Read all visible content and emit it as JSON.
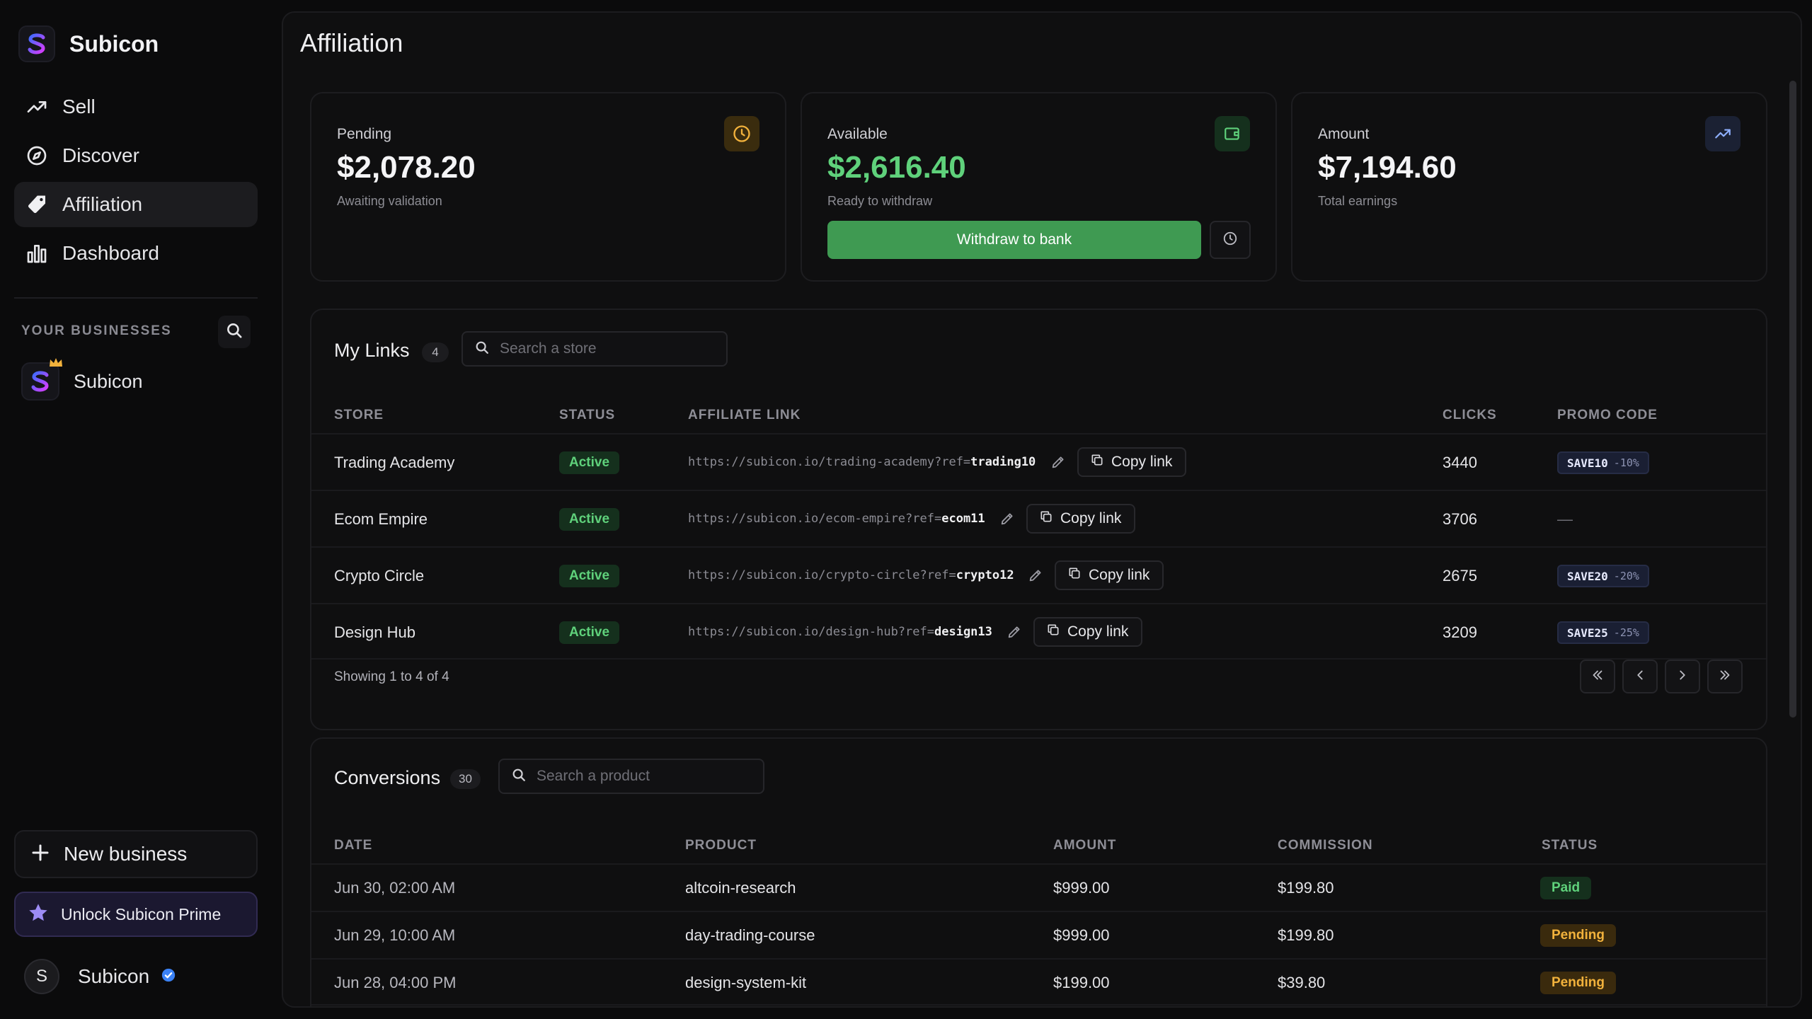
{
  "brand": {
    "name": "Subicon"
  },
  "nav": [
    {
      "label": "Sell",
      "icon": "trending-up-icon"
    },
    {
      "label": "Discover",
      "icon": "compass-icon"
    },
    {
      "label": "Affiliation",
      "icon": "tag-icon",
      "active": true
    },
    {
      "label": "Dashboard",
      "icon": "bar-chart-icon"
    }
  ],
  "businesses": {
    "title": "YOUR BUSINESSES",
    "items": [
      {
        "name": "Subicon"
      }
    ]
  },
  "sidebar_bottom": {
    "new_business": "New business",
    "prime": "Unlock Subicon Prime",
    "user_initial": "S",
    "user_name": "Subicon"
  },
  "page": {
    "title": "Affiliation"
  },
  "stats": {
    "pending": {
      "label": "Pending",
      "value": "$2,078.20",
      "sub": "Awaiting validation"
    },
    "available": {
      "label": "Available",
      "value": "$2,616.40",
      "sub": "Ready to withdraw",
      "button": "Withdraw to bank"
    },
    "amount": {
      "label": "Amount",
      "value": "$7,194.60",
      "sub": "Total earnings"
    }
  },
  "links": {
    "title": "My Links",
    "count": "4",
    "search_placeholder": "Search a store",
    "columns": [
      "STORE",
      "STATUS",
      "AFFILIATE LINK",
      "CLICKS",
      "PROMO CODE"
    ],
    "copy_label": "Copy link",
    "rows": [
      {
        "store": "Trading Academy",
        "status": "Active",
        "link_base": "https://subicon.io/trading-academy?ref=",
        "ref": "trading10",
        "clicks": "3440",
        "promo": "SAVE10",
        "pct": "-10%"
      },
      {
        "store": "Ecom Empire",
        "status": "Active",
        "link_base": "https://subicon.io/ecom-empire?ref=",
        "ref": "ecom11",
        "clicks": "3706",
        "promo": "",
        "pct": "",
        "no_promo": "—"
      },
      {
        "store": "Crypto Circle",
        "status": "Active",
        "link_base": "https://subicon.io/crypto-circle?ref=",
        "ref": "crypto12",
        "clicks": "2675",
        "promo": "SAVE20",
        "pct": "-20%"
      },
      {
        "store": "Design Hub",
        "status": "Active",
        "link_base": "https://subicon.io/design-hub?ref=",
        "ref": "design13",
        "clicks": "3209",
        "promo": "SAVE25",
        "pct": "-25%"
      }
    ],
    "showing": "Showing 1 to 4 of 4"
  },
  "conversions": {
    "title": "Conversions",
    "count": "30",
    "search_placeholder": "Search a product",
    "columns": [
      "DATE",
      "PRODUCT",
      "AMOUNT",
      "COMMISSION",
      "STATUS"
    ],
    "rows": [
      {
        "date": "Jun 30, 02:00 AM",
        "product": "altcoin-research",
        "amount": "$999.00",
        "commission": "$199.80",
        "status": "Paid"
      },
      {
        "date": "Jun 29, 10:00 AM",
        "product": "day-trading-course",
        "amount": "$999.00",
        "commission": "$199.80",
        "status": "Pending"
      },
      {
        "date": "Jun 28, 04:00 PM",
        "product": "design-system-kit",
        "amount": "$199.00",
        "commission": "$39.80",
        "status": "Pending"
      }
    ]
  },
  "colors": {
    "accent_green": "#3f9a52",
    "green_text": "#5fd17b",
    "pending_amber": "#f2b23c",
    "available_value": "#5fd17b"
  }
}
